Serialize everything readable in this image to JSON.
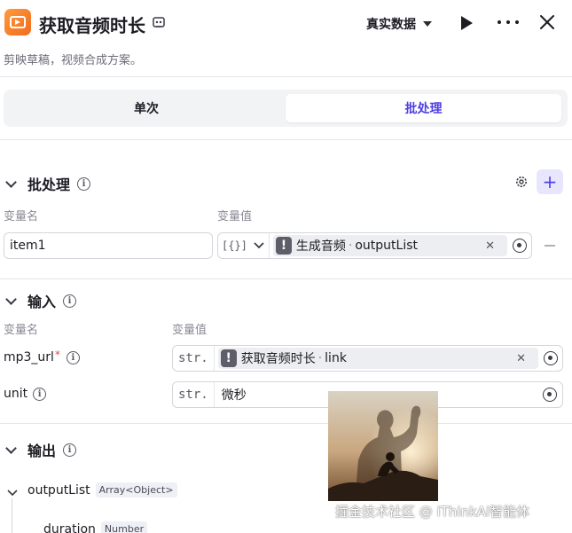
{
  "header": {
    "title": "获取音频时长",
    "subtitle": "剪映草稿，视频合成方案。",
    "mode_label": "真实数据"
  },
  "tabs": [
    {
      "label": "单次",
      "active": false
    },
    {
      "label": "批处理",
      "active": true
    }
  ],
  "batch": {
    "section_title": "批处理",
    "col_name": "变量名",
    "col_value": "变量值",
    "row": {
      "name_value": "item1",
      "type_label": "[{}]",
      "ref_node": "生成音频",
      "ref_sep": "·",
      "ref_field": "outputList"
    }
  },
  "input": {
    "section_title": "输入",
    "col_name": "变量名",
    "col_value": "变量值",
    "rows": [
      {
        "name": "mp3_url",
        "required_mark": "*",
        "type_tag": "str.",
        "ref_node": "获取音频时长",
        "ref_sep": "·",
        "ref_field": "link"
      },
      {
        "name": "unit",
        "type_tag": "str.",
        "value": "微秒"
      }
    ]
  },
  "output": {
    "section_title": "输出",
    "items": [
      {
        "name": "outputList",
        "type": "Array<Object>"
      },
      {
        "name": "duration",
        "type": "Number"
      }
    ]
  },
  "watermark": {
    "text": "掘金技术社区 @ iThinkAi智能体"
  },
  "colors": {
    "accent": "#4e40e5",
    "accent_light": "#e8e6fc",
    "brand_icon": "#f26b1d",
    "text_primary": "#1d1c23",
    "text_muted": "#8a8a96",
    "border": "#d5d6dc"
  },
  "icons": {
    "app": "video-editor-icon",
    "edit": "edit-icon",
    "play": "play-icon",
    "more": "more-icon",
    "close": "close-icon",
    "gear": "gear-icon",
    "add": "plus-icon",
    "info": "info-icon",
    "warning": "warning-icon",
    "picker": "variable-picker-icon"
  }
}
